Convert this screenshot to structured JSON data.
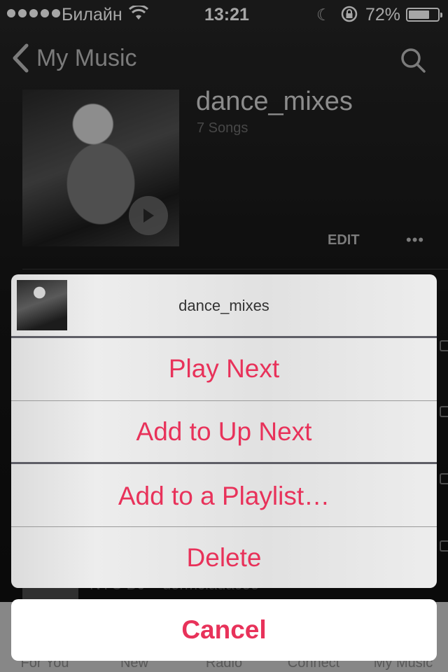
{
  "status_bar": {
    "carrier": "Билайн",
    "time": "13:21",
    "battery_percent": "72%",
    "battery_level": 0.72
  },
  "navbar": {
    "back_label": "My Music"
  },
  "playlist": {
    "title": "dance_mixes",
    "song_count": "7 Songs",
    "edit_label": "EDIT",
    "more_label": "•••"
  },
  "background_list": {
    "row_text": "NYC DJ – dormciadacoo"
  },
  "tab_bar": {
    "tabs": [
      "For You",
      "New",
      "Radio",
      "Connect",
      "My Music"
    ]
  },
  "action_sheet": {
    "title": "dance_mixes",
    "actions": [
      "Play Next",
      "Add to Up Next",
      "Add to a Playlist…",
      "Delete"
    ],
    "cancel_label": "Cancel"
  },
  "colors": {
    "accent": "#e8325a",
    "sheet_background": "#e6e6e6"
  },
  "icons": [
    "cellular-signal-icon",
    "wifi-icon",
    "moon-icon",
    "rotation-lock-icon",
    "battery-icon",
    "back-chevron-icon",
    "search-icon",
    "play-icon"
  ]
}
